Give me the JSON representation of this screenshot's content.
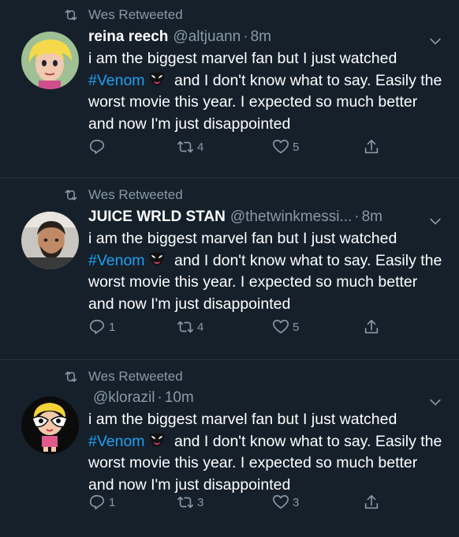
{
  "tweets": [
    {
      "retweeted_by": "Wes Retweeted",
      "name": "reina reech",
      "handle": "@altjuann",
      "time": "8m",
      "body_before": "i am the biggest marvel fan but I just watched ",
      "hashtag": "#Venom",
      "body_after": " and I don't know what to say. Easily the worst movie this year. I expected so much better and now I'm just disappointed",
      "replies": "",
      "retweets": "4",
      "likes": "5"
    },
    {
      "retweeted_by": "Wes Retweeted",
      "name": "JUICE WRLD STAN",
      "handle": "@thetwinkmessi...",
      "time": "8m",
      "body_before": "i am the biggest marvel fan but I just watched ",
      "hashtag": "#Venom",
      "body_after": " and I don't know what to say. Easily the worst movie this year. I expected so much better and now I'm just disappointed",
      "replies": "1",
      "retweets": "4",
      "likes": "5"
    },
    {
      "retweeted_by": "Wes Retweeted",
      "name": "",
      "handle": "@klorazil",
      "time": "10m",
      "body_before": "i am the biggest marvel fan but I just watched ",
      "hashtag": "#Venom",
      "body_after": " and I don't know what to say. Easily the worst movie this year. I expected so much better and now I'm just disappointed",
      "replies": "1",
      "retweets": "3",
      "likes": "3"
    }
  ],
  "colors": {
    "background": "#15202b",
    "muted": "#8899a6",
    "link": "#1da1f2",
    "divider": "#253341"
  },
  "icons": [
    "retweet-icon",
    "chevron-down-icon",
    "reply-icon",
    "heart-icon",
    "share-icon",
    "venom-emoji"
  ]
}
